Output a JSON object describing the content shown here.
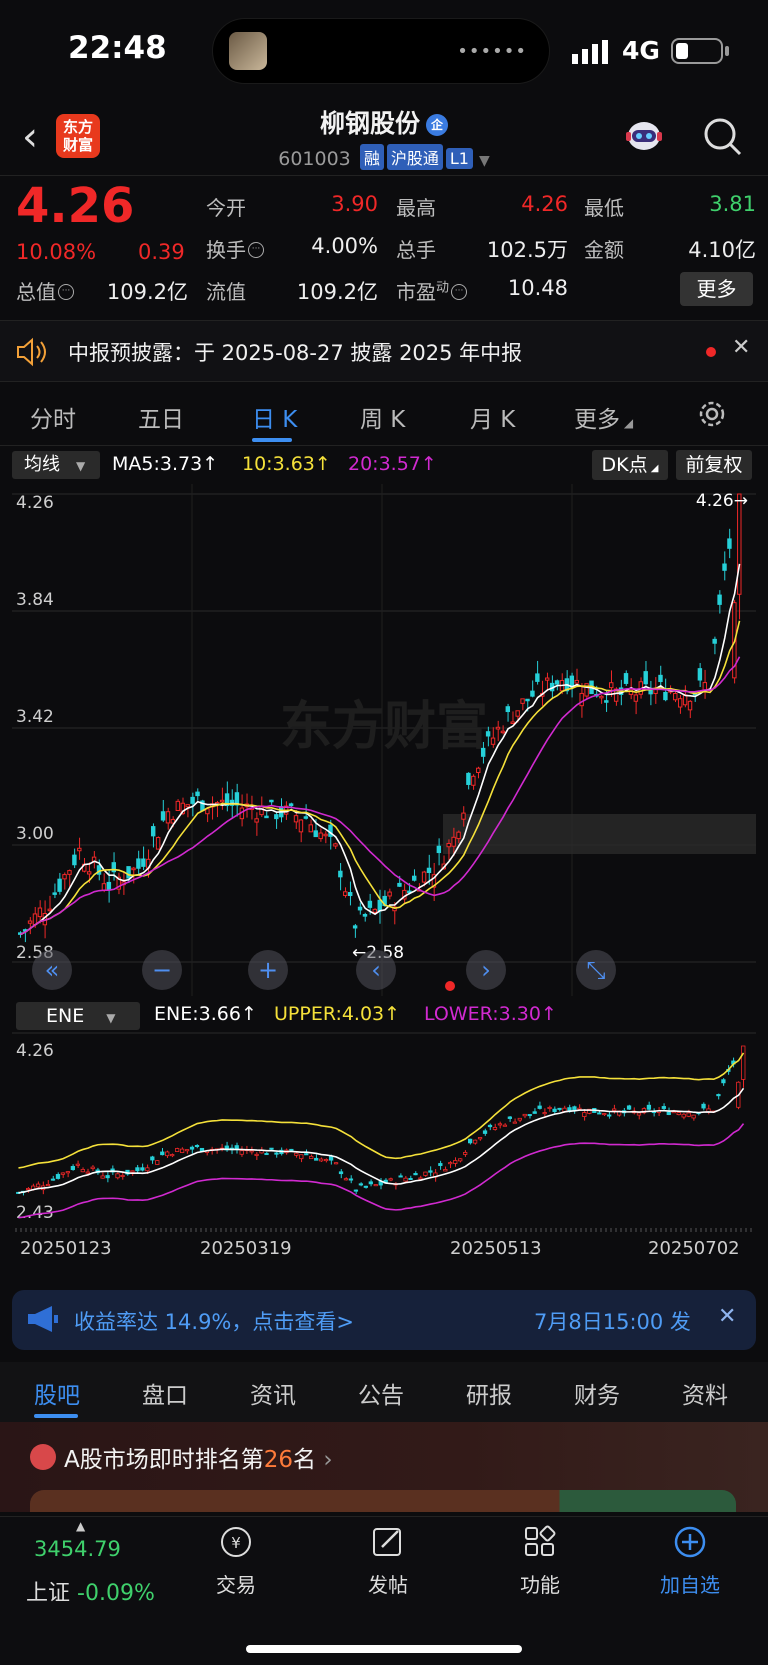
{
  "status": {
    "time": "22:48",
    "network": "4G"
  },
  "header": {
    "name": "柳钢股份",
    "ent_badge": "企",
    "code": "601003",
    "tags": [
      "融",
      "沪股通",
      "L1"
    ],
    "logo": "东方\n财富"
  },
  "quote": {
    "price": "4.26",
    "change_pct": "10.08%",
    "change_amt": "0.39",
    "open_label": "今开",
    "open": "3.90",
    "high_label": "最高",
    "high": "4.26",
    "low_label": "最低",
    "low": "3.81",
    "turnover_label": "换手",
    "turnover": "4.00%",
    "volume_label": "总手",
    "volume": "102.5万",
    "amount_label": "金额",
    "amount": "4.10亿",
    "mcap_label": "总值",
    "mcap": "109.2亿",
    "float_label": "流值",
    "float": "109.2亿",
    "pe_label": "市盈",
    "pe_sup": "动",
    "pe": "10.48",
    "more": "更多"
  },
  "notice": {
    "text": "中报预披露：于 2025-08-27 披露 2025 年中报"
  },
  "tabs": [
    "分时",
    "五日",
    "日 K",
    "周 K",
    "月 K",
    "更多"
  ],
  "ma": {
    "select": "均线",
    "ma5": "MA5:3.73",
    "ma10": "10:3.63",
    "ma20": "20:3.57",
    "dk": "DK点",
    "fq": "前复权"
  },
  "colors": {
    "up": "#f02828",
    "down": "#26d0d8",
    "ma5": "#ffffff",
    "ma10": "#f5e13a",
    "ma20": "#d12ad0",
    "accent": "#3d8ef0"
  },
  "chart_data": {
    "type": "candlestick",
    "y_ticks": [
      "4.26",
      "3.84",
      "3.42",
      "3.00",
      "2.58"
    ],
    "ylim": [
      2.58,
      4.26
    ],
    "max_label": "4.26",
    "min_label": "2.58",
    "watermark": "东方财富"
  },
  "ene": {
    "select": "ENE",
    "ene": "ENE:3.66",
    "upper": "UPPER:4.03",
    "lower": "LOWER:3.30",
    "y_top": "4.26",
    "y_bottom": "2.43"
  },
  "dates": [
    "20250123",
    "20250319",
    "20250513",
    "20250702"
  ],
  "promo": {
    "text": "收益率达 14.9%，点击查看>",
    "time": "7月8日15:00 发"
  },
  "bottom_tabs": [
    "股吧",
    "盘口",
    "资讯",
    "公告",
    "研报",
    "财务",
    "资料"
  ],
  "rank": {
    "prefix": "A股市场即时排名第",
    "num": "26",
    "suffix": "名"
  },
  "index": {
    "value": "3454.79",
    "name": "上证",
    "change": "-0.09%"
  },
  "nav": [
    "交易",
    "发帖",
    "功能",
    "加自选"
  ]
}
